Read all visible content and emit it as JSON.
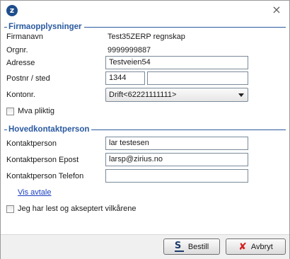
{
  "window": {
    "logo_glyph": "z",
    "close_glyph": "×"
  },
  "company_section": {
    "title": "Firmaopplysninger",
    "company_name_label": "Firmanavn",
    "company_name_value": "Test35ZERP regnskap",
    "org_nr_label": "Orgnr.",
    "org_nr_value": "9999999887",
    "address_label": "Adresse",
    "address_value": "Testveien54",
    "postal_label": "Postnr / sted",
    "postal_code_value": "1344",
    "postal_place_value": "",
    "account_label": "Kontonr.",
    "account_selected": "Drift<62221111111>",
    "vat_label": "Mva pliktig"
  },
  "contact_section": {
    "title": "Hovedkontaktperson",
    "contact_label": "Kontaktperson",
    "contact_value": "lar testesen",
    "email_label": "Kontaktperson Epost",
    "email_value": "larsp@zirius.no",
    "phone_label": "Kontaktperson Telefon",
    "phone_value": ""
  },
  "agreement_link": "Vis avtale",
  "terms_label": "Jeg har lest og akseptert vilkårene",
  "footer": {
    "order_button": "Bestill",
    "order_icon": "S",
    "cancel_button": "Avbryt",
    "cancel_icon": "✘"
  }
}
